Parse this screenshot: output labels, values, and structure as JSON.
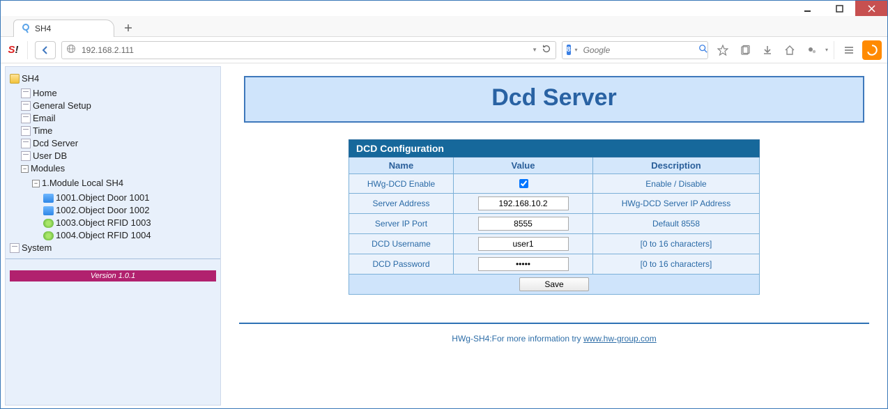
{
  "window": {
    "tab_title": "SH4",
    "url": "192.168.2.111",
    "search_placeholder": "Google"
  },
  "sidebar": {
    "root": "SH4",
    "items": [
      "Home",
      "General Setup",
      "Email",
      "Time",
      "Dcd Server",
      "User DB"
    ],
    "modules_label": "Modules",
    "module1_label": "1.Module Local SH4",
    "objects": [
      {
        "label": "1001.Object Door 1001",
        "kind": "blue"
      },
      {
        "label": "1002.Object Door 1002",
        "kind": "blue"
      },
      {
        "label": "1003.Object RFID 1003",
        "kind": "green"
      },
      {
        "label": "1004.Object RFID 1004",
        "kind": "green"
      }
    ],
    "system_label": "System",
    "version": "Version 1.0.1"
  },
  "page": {
    "title": "Dcd Server",
    "section_title": "DCD Configuration",
    "cols": {
      "name": "Name",
      "value": "Value",
      "desc": "Description"
    },
    "rows": [
      {
        "name": "HWg-DCD Enable",
        "value_type": "checkbox",
        "value": "true",
        "desc": "Enable / Disable"
      },
      {
        "name": "Server Address",
        "value_type": "text",
        "value": "192.168.10.2",
        "desc": "HWg-DCD Server IP Address"
      },
      {
        "name": "Server IP Port",
        "value_type": "text",
        "value": "8555",
        "desc": "Default 8558"
      },
      {
        "name": "DCD Username",
        "value_type": "text",
        "value": "user1",
        "desc": "[0 to 16 characters]"
      },
      {
        "name": "DCD Password",
        "value_type": "password",
        "value": "•••••",
        "desc": "[0 to 16 characters]"
      }
    ],
    "save_label": "Save"
  },
  "footer": {
    "text": "HWg-SH4:For more information try ",
    "link": "www.hw-group.com"
  }
}
